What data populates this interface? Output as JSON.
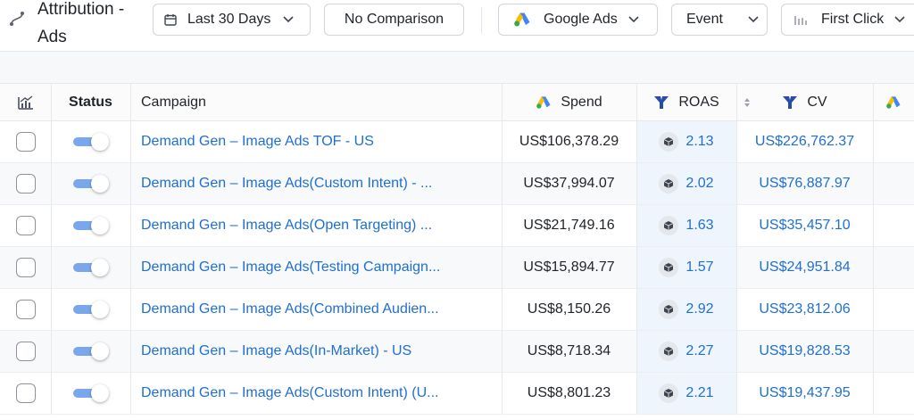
{
  "header": {
    "title": "Attribution - Ads",
    "date_range": "Last 30 Days",
    "comparison": "No Comparison",
    "platform": "Google Ads",
    "event": "Event",
    "attribution_model": "First Click"
  },
  "table": {
    "columns": {
      "status": "Status",
      "campaign": "Campaign",
      "spend": "Spend",
      "roas": "ROAS",
      "cv": "CV"
    },
    "rows": [
      {
        "campaign": "Demand Gen – Image Ads TOF - US",
        "spend": "US$106,378.29",
        "roas": "2.13",
        "cv": "US$226,762.37"
      },
      {
        "campaign": "Demand Gen – Image Ads(Custom Intent) - ...",
        "spend": "US$37,994.07",
        "roas": "2.02",
        "cv": "US$76,887.97"
      },
      {
        "campaign": "Demand Gen – Image Ads(Open Targeting) ...",
        "spend": "US$21,749.16",
        "roas": "1.63",
        "cv": "US$35,457.10"
      },
      {
        "campaign": "Demand Gen – Image Ads(Testing Campaign...",
        "spend": "US$15,894.77",
        "roas": "1.57",
        "cv": "US$24,951.84"
      },
      {
        "campaign": "Demand Gen – Image Ads(Combined Audien...",
        "spend": "US$8,150.26",
        "roas": "2.92",
        "cv": "US$23,812.06"
      },
      {
        "campaign": "Demand Gen – Image Ads(In-Market) - US",
        "spend": "US$8,718.34",
        "roas": "2.27",
        "cv": "US$19,828.53"
      },
      {
        "campaign": "Demand Gen – Image Ads(Custom Intent) (U...",
        "spend": "US$8,801.23",
        "roas": "2.21",
        "cv": "US$19,437.95"
      }
    ]
  },
  "colors": {
    "link": "#1f6fd1",
    "toggle_on": "#7aa7ec",
    "roas_column_bg": "#eef5fd",
    "google_blue": "#4285F4",
    "google_yellow": "#FBBC04",
    "google_green": "#34A853",
    "brand_navy": "#2a4ca8"
  },
  "icons": {
    "title": "attribution-path-icon",
    "date": "calendar-icon",
    "platform": "google-ads-icon",
    "model": "bar-chart-icon",
    "dropdown": "chevron-down-icon",
    "metric_brand": "brand-y-icon",
    "roas_badge": "cube-icon",
    "sort": "sort-icon",
    "column_settings": "chart-settings-icon"
  }
}
